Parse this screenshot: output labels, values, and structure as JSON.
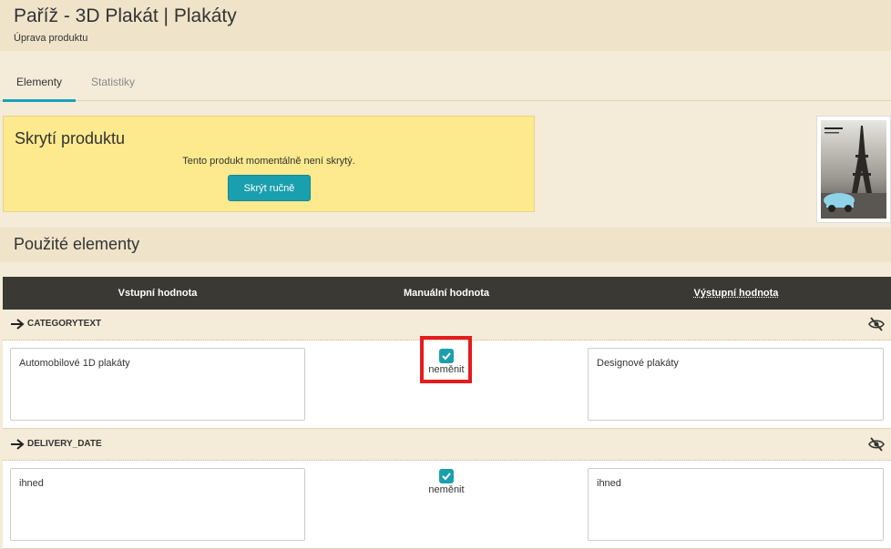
{
  "header": {
    "title": "Paříž - 3D Plakát | Plakáty",
    "subtitle": "Úprava produktu"
  },
  "tabs": [
    {
      "label": "Elementy",
      "active": true
    },
    {
      "label": "Statistiky",
      "active": false
    }
  ],
  "hide_panel": {
    "title": "Skrytí produktu",
    "status_text": "Tento produkt momentálně není skrytý.",
    "button_label": "Skrýt ručně"
  },
  "product_thumbnail": {
    "icon": "eiffel-tower-poster-image"
  },
  "elements_section": {
    "title": "Použité elementy"
  },
  "table": {
    "columns": [
      "Vstupní hodnota",
      "Manuální hodnota",
      "Výstupní hodnota"
    ],
    "rows": [
      {
        "code": "CATEGORYTEXT",
        "input_value": "Automobilové 1D plakáty",
        "checkbox_checked": true,
        "checkbox_label": "neměnit",
        "output_value": "Designové plakáty"
      },
      {
        "code": "DELIVERY_DATE",
        "input_value": "ihned",
        "checkbox_checked": true,
        "checkbox_label": "neměnit",
        "output_value": "ihned"
      }
    ]
  },
  "colors": {
    "accent": "#1a9fae",
    "highlight": "#e41c1c",
    "panel_yellow": "#fde98e",
    "table_header": "#3b3934"
  }
}
